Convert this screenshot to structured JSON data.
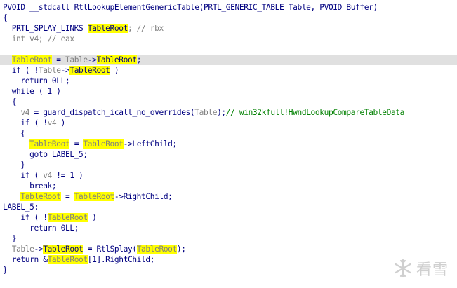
{
  "code": {
    "lines": [
      {
        "hl": false,
        "tokens": [
          {
            "t": "PVOID __stdcall RtlLookupElementGenericTable(PRTL_GENERIC_TABLE Table, PVOID Buffer)",
            "c": "def"
          }
        ]
      },
      {
        "hl": false,
        "tokens": [
          {
            "t": "{",
            "c": "def"
          }
        ]
      },
      {
        "hl": false,
        "tokens": [
          {
            "t": "  PRTL_SPLAY_LINKS ",
            "c": "def"
          },
          {
            "t": "TableRoot",
            "c": "hl"
          },
          {
            "t": "; // rbx",
            "c": "gray"
          }
        ]
      },
      {
        "hl": false,
        "tokens": [
          {
            "t": "  int v4; // eax",
            "c": "gray"
          }
        ]
      },
      {
        "hl": false,
        "tokens": [
          {
            "t": "",
            "c": "def"
          }
        ]
      },
      {
        "hl": true,
        "tokens": [
          {
            "t": "  ",
            "c": "def"
          },
          {
            "t": "TableRoot",
            "c": "hlvar"
          },
          {
            "t": " = ",
            "c": "def"
          },
          {
            "t": "Table",
            "c": "var"
          },
          {
            "t": "->",
            "c": "def"
          },
          {
            "t": "TableRoot",
            "c": "hl"
          },
          {
            "t": ";",
            "c": "def"
          }
        ]
      },
      {
        "hl": false,
        "tokens": [
          {
            "t": "  if ( !",
            "c": "def"
          },
          {
            "t": "Table",
            "c": "var"
          },
          {
            "t": "->",
            "c": "def"
          },
          {
            "t": "TableRoot",
            "c": "hl"
          },
          {
            "t": " )",
            "c": "def"
          }
        ]
      },
      {
        "hl": false,
        "tokens": [
          {
            "t": "    return 0LL;",
            "c": "def"
          }
        ]
      },
      {
        "hl": false,
        "tokens": [
          {
            "t": "  while ( 1 )",
            "c": "def"
          }
        ]
      },
      {
        "hl": false,
        "tokens": [
          {
            "t": "  {",
            "c": "def"
          }
        ]
      },
      {
        "hl": false,
        "tokens": [
          {
            "t": "    ",
            "c": "def"
          },
          {
            "t": "v4",
            "c": "var"
          },
          {
            "t": " = guard_dispatch_icall_no_overrides(",
            "c": "def"
          },
          {
            "t": "Table",
            "c": "var"
          },
          {
            "t": ");",
            "c": "def"
          },
          {
            "t": "// win32kfull!HwndLookupCompareTableData",
            "c": "green"
          }
        ]
      },
      {
        "hl": false,
        "tokens": [
          {
            "t": "    if ( !",
            "c": "def"
          },
          {
            "t": "v4",
            "c": "var"
          },
          {
            "t": " )",
            "c": "def"
          }
        ]
      },
      {
        "hl": false,
        "tokens": [
          {
            "t": "    {",
            "c": "def"
          }
        ]
      },
      {
        "hl": false,
        "tokens": [
          {
            "t": "      ",
            "c": "def"
          },
          {
            "t": "TableRoot",
            "c": "hlvar"
          },
          {
            "t": " = ",
            "c": "def"
          },
          {
            "t": "TableRoot",
            "c": "hlvar"
          },
          {
            "t": "->LeftChild;",
            "c": "def"
          }
        ]
      },
      {
        "hl": false,
        "tokens": [
          {
            "t": "      goto LABEL_5;",
            "c": "def"
          }
        ]
      },
      {
        "hl": false,
        "tokens": [
          {
            "t": "    }",
            "c": "def"
          }
        ]
      },
      {
        "hl": false,
        "tokens": [
          {
            "t": "    if ( ",
            "c": "def"
          },
          {
            "t": "v4",
            "c": "var"
          },
          {
            "t": " != 1 )",
            "c": "def"
          }
        ]
      },
      {
        "hl": false,
        "tokens": [
          {
            "t": "      break;",
            "c": "def"
          }
        ]
      },
      {
        "hl": false,
        "tokens": [
          {
            "t": "    ",
            "c": "def"
          },
          {
            "t": "TableRoot",
            "c": "hlvar"
          },
          {
            "t": " = ",
            "c": "def"
          },
          {
            "t": "TableRoot",
            "c": "hlvar"
          },
          {
            "t": "->RightChild;",
            "c": "def"
          }
        ]
      },
      {
        "hl": false,
        "tokens": [
          {
            "t": "LABEL_5:",
            "c": "def"
          }
        ]
      },
      {
        "hl": false,
        "tokens": [
          {
            "t": "    if ( !",
            "c": "def"
          },
          {
            "t": "TableRoot",
            "c": "hlvar"
          },
          {
            "t": " )",
            "c": "def"
          }
        ]
      },
      {
        "hl": false,
        "tokens": [
          {
            "t": "      return 0LL;",
            "c": "def"
          }
        ]
      },
      {
        "hl": false,
        "tokens": [
          {
            "t": "  }",
            "c": "def"
          }
        ]
      },
      {
        "hl": false,
        "tokens": [
          {
            "t": "  ",
            "c": "def"
          },
          {
            "t": "Table",
            "c": "var"
          },
          {
            "t": "->",
            "c": "def"
          },
          {
            "t": "TableRoot",
            "c": "hl"
          },
          {
            "t": " = RtlSplay(",
            "c": "def"
          },
          {
            "t": "TableRoot",
            "c": "hlvar"
          },
          {
            "t": ");",
            "c": "def"
          }
        ]
      },
      {
        "hl": false,
        "tokens": [
          {
            "t": "  return &",
            "c": "def"
          },
          {
            "t": "TableRoot",
            "c": "hlvar"
          },
          {
            "t": "[1].RightChild;",
            "c": "def"
          }
        ]
      },
      {
        "hl": false,
        "tokens": [
          {
            "t": "}",
            "c": "def"
          }
        ]
      }
    ]
  },
  "watermark": {
    "text": "看雪",
    "icon": "snowflake-icon"
  },
  "colors": {
    "default_text": "#000080",
    "comment_gray": "#808080",
    "comment_green": "#008000",
    "highlight_yellow": "#ffff00",
    "current_line": "#e0e0e0"
  }
}
